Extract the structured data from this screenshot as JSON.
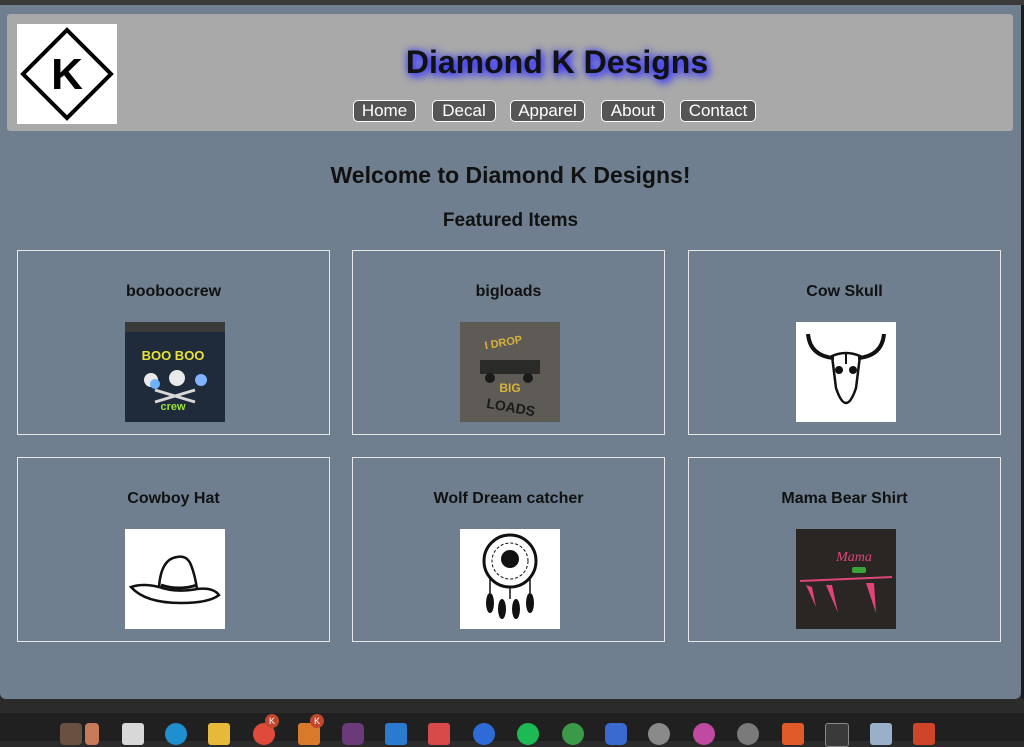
{
  "header": {
    "title": "Diamond K Designs",
    "logo_letter": "K",
    "nav": [
      {
        "label": "Home"
      },
      {
        "label": "Decal"
      },
      {
        "label": "Apparel"
      },
      {
        "label": "About"
      },
      {
        "label": "Contact"
      }
    ]
  },
  "main": {
    "welcome": "Welcome to Diamond K Designs!",
    "featured_heading": "Featured Items",
    "items": [
      {
        "title": "booboocrew",
        "image": "boo-boo-crew-shirt",
        "img_text": "BOO BOO",
        "img_text2": "crew"
      },
      {
        "title": "bigloads",
        "image": "big-loads-shirt",
        "img_text": "I DROP",
        "img_text2": "BIG",
        "img_text3": "LOADS"
      },
      {
        "title": "Cow Skull",
        "image": "cow-skull-graphic"
      },
      {
        "title": "Cowboy Hat",
        "image": "cowboy-hat-graphic"
      },
      {
        "title": "Wolf Dream catcher",
        "image": "wolf-dreamcatcher-graphic"
      },
      {
        "title": "Mama Bear Shirt",
        "image": "mama-bear-shirt",
        "img_text": "Mama"
      }
    ]
  },
  "taskbar": {
    "apps": [
      "user-avatar",
      "file",
      "edge",
      "file-explorer",
      "chrome",
      "app",
      "slack",
      "vscode",
      "snip",
      "zoom",
      "spotify",
      "chrome",
      "copilot",
      "settings",
      "chrome-canary",
      "settings",
      "ubuntu",
      "terminal",
      "monitor",
      "powerpoint"
    ],
    "badge_label": "K"
  },
  "colors": {
    "page_bg": "#6f7f8f",
    "header_bg": "#a9a9a9",
    "nav_bg": "#555555",
    "title_glow": "#2b2bff"
  }
}
